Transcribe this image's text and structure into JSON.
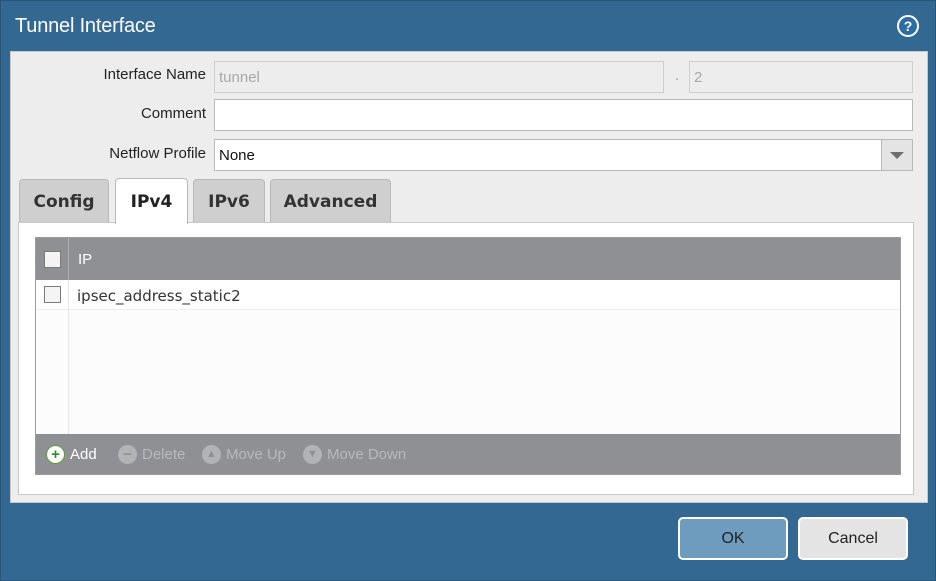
{
  "window": {
    "title": "Tunnel Interface",
    "help_icon": "help-icon"
  },
  "form": {
    "interface_name_label": "Interface Name",
    "interface_name_value": "tunnel",
    "interface_separator": ".",
    "interface_suffix_value": "2",
    "comment_label": "Comment",
    "comment_value": "",
    "netflow_label": "Netflow Profile",
    "netflow_value": "None"
  },
  "tabs": [
    {
      "label": "Config",
      "active": false
    },
    {
      "label": "IPv4",
      "active": true
    },
    {
      "label": "IPv6",
      "active": false
    },
    {
      "label": "Advanced",
      "active": false
    }
  ],
  "ip_table": {
    "column_header": "IP",
    "rows": [
      {
        "value": "ipsec_address_static2",
        "checked": false
      }
    ]
  },
  "toolbar": {
    "add_label": "Add",
    "delete_label": "Delete",
    "move_up_label": "Move Up",
    "move_down_label": "Move Down"
  },
  "buttons": {
    "ok_label": "OK",
    "cancel_label": "Cancel"
  },
  "colors": {
    "title_bar": "#336892",
    "panel": "#ededed",
    "grid_header": "#8e9093",
    "ok_button": "#6e9cbf",
    "add_icon": "#2f8a2f"
  }
}
